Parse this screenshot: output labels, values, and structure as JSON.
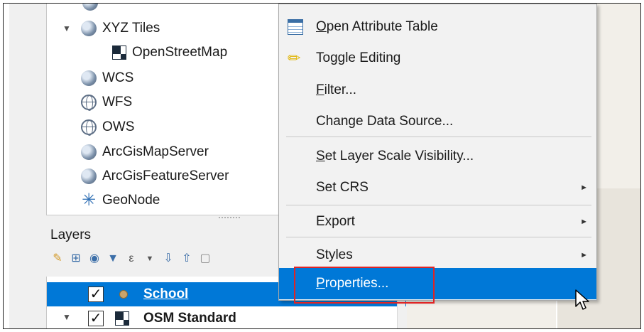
{
  "browser_tree": [
    {
      "label": "XYZ Tiles",
      "icon": "globe-icon",
      "expanded": true
    },
    {
      "label": "OpenStreetMap",
      "icon": "checker-tile-icon"
    },
    {
      "label": "WCS",
      "icon": "globe-icon"
    },
    {
      "label": "WFS",
      "icon": "wfs-globe-icon"
    },
    {
      "label": "OWS",
      "icon": "globe-outline-icon"
    },
    {
      "label": "ArcGisMapServer",
      "icon": "globe-icon"
    },
    {
      "label": "ArcGisFeatureServer",
      "icon": "globe-icon"
    },
    {
      "label": "GeoNode",
      "icon": "geonode-icon"
    }
  ],
  "layers_panel": {
    "title": "Layers",
    "toolbar_icons": [
      "style-brush-icon",
      "add-group-icon",
      "eye-icon",
      "filter-icon",
      "expression-filter-icon",
      "dropdown-arrow-icon",
      "expand-all-icon",
      "collapse-all-icon",
      "remove-layer-icon"
    ],
    "layers": [
      {
        "name": "School",
        "checked": true,
        "selected": true,
        "check_glyph": "✓"
      },
      {
        "name": "OSM Standard",
        "checked": true,
        "selected": false,
        "check_glyph": "✓"
      }
    ]
  },
  "context_menu": {
    "items": [
      {
        "label_pre": "",
        "label_u": "O",
        "label_post": "pen Attribute Table",
        "icon": "table-icon"
      },
      {
        "label_pre": "",
        "label_u": "",
        "label_post": "Toggle Editing",
        "icon": "pencil-icon"
      },
      {
        "label_pre": "",
        "label_u": "F",
        "label_post": "ilter...",
        "icon": ""
      },
      {
        "label_pre": "Change Data Source...",
        "label_u": "",
        "label_post": "",
        "icon": ""
      },
      {
        "label_pre": "",
        "label_u": "S",
        "label_post": "et Layer Scale Visibility...",
        "icon": ""
      },
      {
        "label_pre": "Set CRS",
        "label_u": "",
        "label_post": "",
        "icon": "",
        "submenu": true
      },
      {
        "label_pre": "Export",
        "label_u": "",
        "label_post": "",
        "icon": "",
        "submenu": true
      },
      {
        "label_pre": "Styles",
        "label_u": "",
        "label_post": "",
        "icon": "",
        "submenu": true
      },
      {
        "label_pre": "",
        "label_u": "P",
        "label_post": "roperties...",
        "icon": "",
        "highlighted": true
      }
    ],
    "submenu_glyph": "►"
  },
  "colors": {
    "selection": "#0078d7",
    "highlight_box": "#e02424",
    "menu_bg": "#f2f2f2"
  }
}
